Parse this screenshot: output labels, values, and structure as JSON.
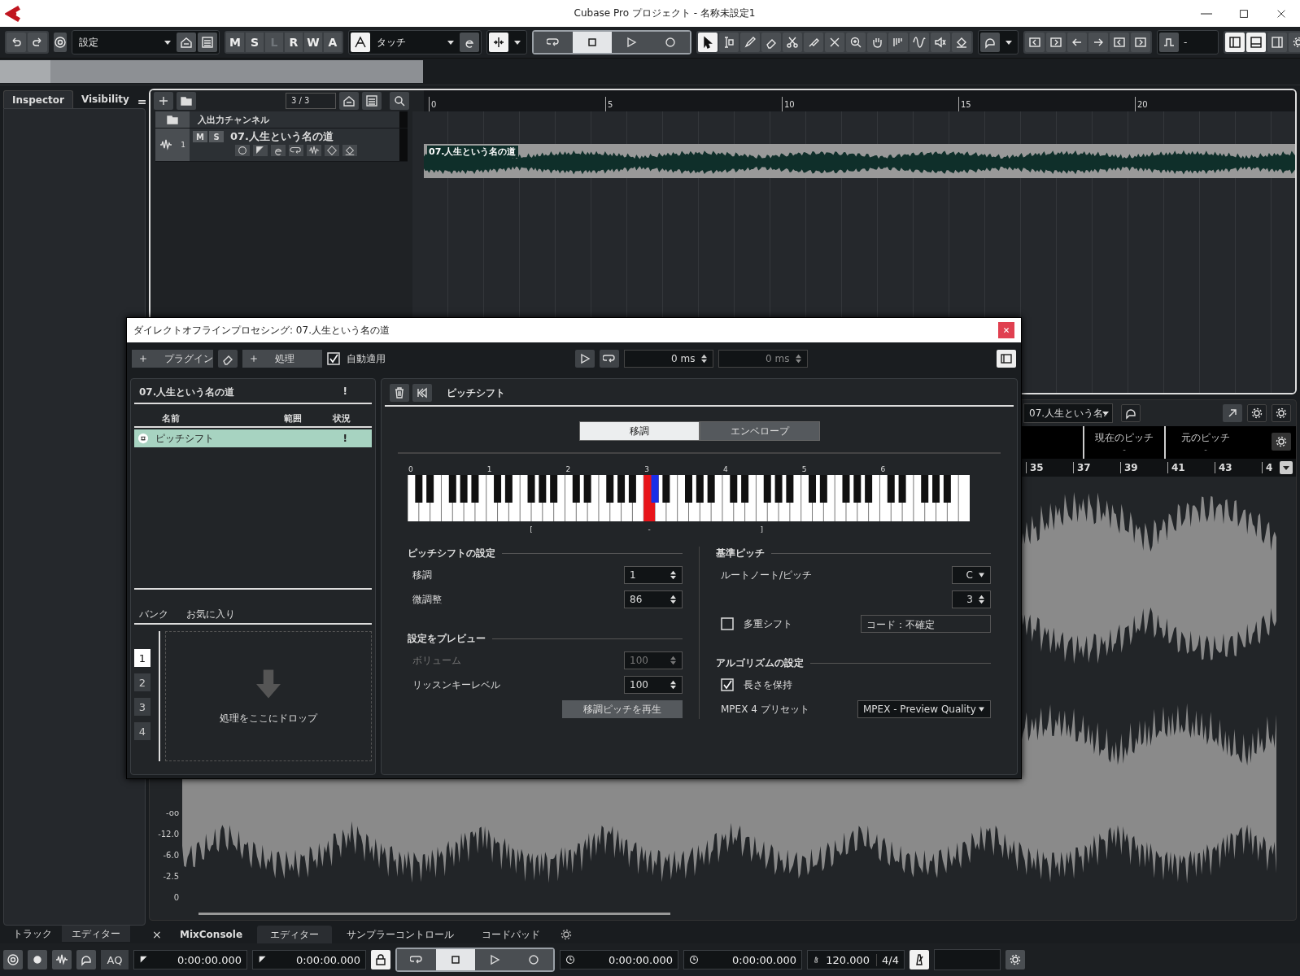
{
  "window": {
    "title": "Cubase Pro プロジェクト - 名称未設定1"
  },
  "toolbar": {
    "preset": "設定",
    "automation_buttons": [
      {
        "label": "M",
        "disabled": false
      },
      {
        "label": "S",
        "disabled": false
      },
      {
        "label": "L",
        "disabled": true
      },
      {
        "label": "R",
        "disabled": false
      },
      {
        "label": "W",
        "disabled": false
      },
      {
        "label": "A",
        "disabled": false
      }
    ],
    "automation_mode": "タッチ",
    "transport": [
      {
        "kind": "loop",
        "selected": false
      },
      {
        "kind": "stop",
        "selected": true
      },
      {
        "kind": "play",
        "selected": false
      },
      {
        "kind": "record",
        "selected": false
      }
    ],
    "tools": [
      {
        "kind": "arrow",
        "selected": true
      },
      {
        "kind": "range",
        "selected": false
      },
      {
        "kind": "pencil",
        "selected": false
      },
      {
        "kind": "eraser",
        "selected": false
      },
      {
        "kind": "scissors",
        "selected": false
      },
      {
        "kind": "glue",
        "selected": false
      },
      {
        "kind": "cross",
        "selected": false
      },
      {
        "kind": "zoom",
        "selected": false
      },
      {
        "kind": "hand",
        "selected": false
      },
      {
        "kind": "bars",
        "selected": false
      },
      {
        "kind": "wave",
        "selected": false
      },
      {
        "kind": "speaker",
        "selected": false
      },
      {
        "kind": "bucket",
        "selected": false
      }
    ],
    "quantize": "-",
    "layout_buttons": [
      {
        "kind": "left",
        "selected": true
      },
      {
        "kind": "bottom",
        "selected": true
      },
      {
        "kind": "right",
        "selected": false
      },
      {
        "kind": "gear",
        "selected": false
      }
    ]
  },
  "inspector": {
    "tabs": [
      {
        "label": "Inspector",
        "selected": true
      },
      {
        "label": "Visibility",
        "selected": false
      }
    ],
    "menu_glyph": "="
  },
  "project": {
    "track_count": "3 / 3",
    "tracks": [
      {
        "kind": "folder",
        "name": "入出力チャンネル"
      },
      {
        "kind": "audio",
        "number": "1",
        "name": "07.人生という名の道",
        "buttons": [
          "M",
          "S"
        ]
      }
    ],
    "ruler": [
      "0",
      "5",
      "10",
      "15",
      "20"
    ],
    "event": {
      "name": "07.人生という名の道"
    }
  },
  "editor": {
    "clip": "07.人生という名.",
    "columns": [
      {
        "label": "現在のピッチ",
        "value": "-"
      },
      {
        "label": "元のピッチ",
        "value": "-"
      }
    ],
    "ruler": [
      "35",
      "37",
      "39",
      "41",
      "43",
      "4"
    ],
    "amplitude_labels": [
      "-oo",
      "-12.0",
      "-6.0",
      "-2.5",
      "0"
    ]
  },
  "lower_zone": {
    "left_tabs": [
      {
        "label": "トラック",
        "selected": false
      },
      {
        "label": "エディター",
        "selected": true
      }
    ],
    "close_glyph": "×",
    "tabs": [
      {
        "label": "MixConsole",
        "selected": false
      },
      {
        "label": "エディター",
        "selected": true
      },
      {
        "label": "サンプラーコントロール",
        "selected": false
      },
      {
        "label": "コードパッド",
        "selected": false
      }
    ]
  },
  "transport_bar": {
    "aq": "AQ",
    "left_locator": "0:00:00.000",
    "right_locator": "0:00:00.000",
    "transport": [
      {
        "kind": "loop",
        "selected": false
      },
      {
        "kind": "stop",
        "selected": true
      },
      {
        "kind": "play",
        "selected": false
      },
      {
        "kind": "record",
        "selected": false
      }
    ],
    "primary_time": "0:00:00.000",
    "secondary_time": "0:00:00.000",
    "tempo": "120.000",
    "signature": "4/4"
  },
  "dialog": {
    "title": "ダイレクトオフラインプロセシング: 07.人生という名の道",
    "plugin_button": "プラグイン",
    "process_button": "処理",
    "auto_apply": {
      "label": "自動適用",
      "checked": true
    },
    "pre_roll": "0 ms",
    "post_roll": "0 ms",
    "clip": "07.人生という名の道",
    "clip_status": "!",
    "columns": [
      "名前",
      "範囲",
      "状況"
    ],
    "processes": [
      {
        "name": "ピッチシフト",
        "status": "!",
        "selected": true
      }
    ],
    "bank_tabs": [
      "バンク",
      "お気に入り"
    ],
    "banks": [
      {
        "label": "1",
        "selected": true
      },
      {
        "label": "2",
        "selected": false
      },
      {
        "label": "3",
        "selected": false
      },
      {
        "label": "4",
        "selected": false
      }
    ],
    "drop_hint": "処理をここにドロップ",
    "plugin_title": "ピッチシフト",
    "tabs": [
      {
        "label": "移調",
        "selected": true
      },
      {
        "label": "エンベロープ",
        "selected": false
      }
    ],
    "keyboard": {
      "octaves": [
        {
          "label": "0"
        },
        {
          "label": "1",
          "range_marks": [
            {
              "text": "[",
              "kind": "fsharp"
            }
          ]
        },
        {
          "label": "2"
        },
        {
          "label": "3",
          "marked_keys": [
            {
              "kind": "c",
              "color": "#e8141a"
            },
            {
              "kind": "csharp",
              "color": "#1a2ee8"
            }
          ],
          "range_marks": [
            {
              "text": "-",
              "kind": "c"
            }
          ]
        },
        {
          "label": "4",
          "range_marks": [
            {
              "text": "]",
              "kind": "f"
            }
          ]
        },
        {
          "label": "5"
        },
        {
          "label": "6"
        }
      ]
    },
    "pitch_shift": {
      "title": "ピッチシフトの設定",
      "fields": [
        {
          "label": "移調",
          "value": "1",
          "disabled": false
        },
        {
          "label": "微調整",
          "value": "86",
          "disabled": false
        }
      ]
    },
    "preview": {
      "title": "設定をプレビュー",
      "fields": [
        {
          "label": "ボリューム",
          "value": "100",
          "disabled": true
        },
        {
          "label": "リッスンキーレベル",
          "value": "100",
          "disabled": false
        }
      ],
      "button": "移調ピッチを再生"
    },
    "base_pitch": {
      "title": "基準ピッチ",
      "root_label": "ルートノート/ピッチ",
      "root_note": "C",
      "octave": "3",
      "multi_shift": {
        "label": "多重シフト",
        "checked": false
      },
      "chord": "コード：不確定"
    },
    "algorithm": {
      "title": "アルゴリズムの設定",
      "keep_length": {
        "label": "長さを保持",
        "checked": true
      },
      "preset_label": "MPEX 4 プリセット",
      "preset": "MPEX - Preview Quality"
    }
  }
}
